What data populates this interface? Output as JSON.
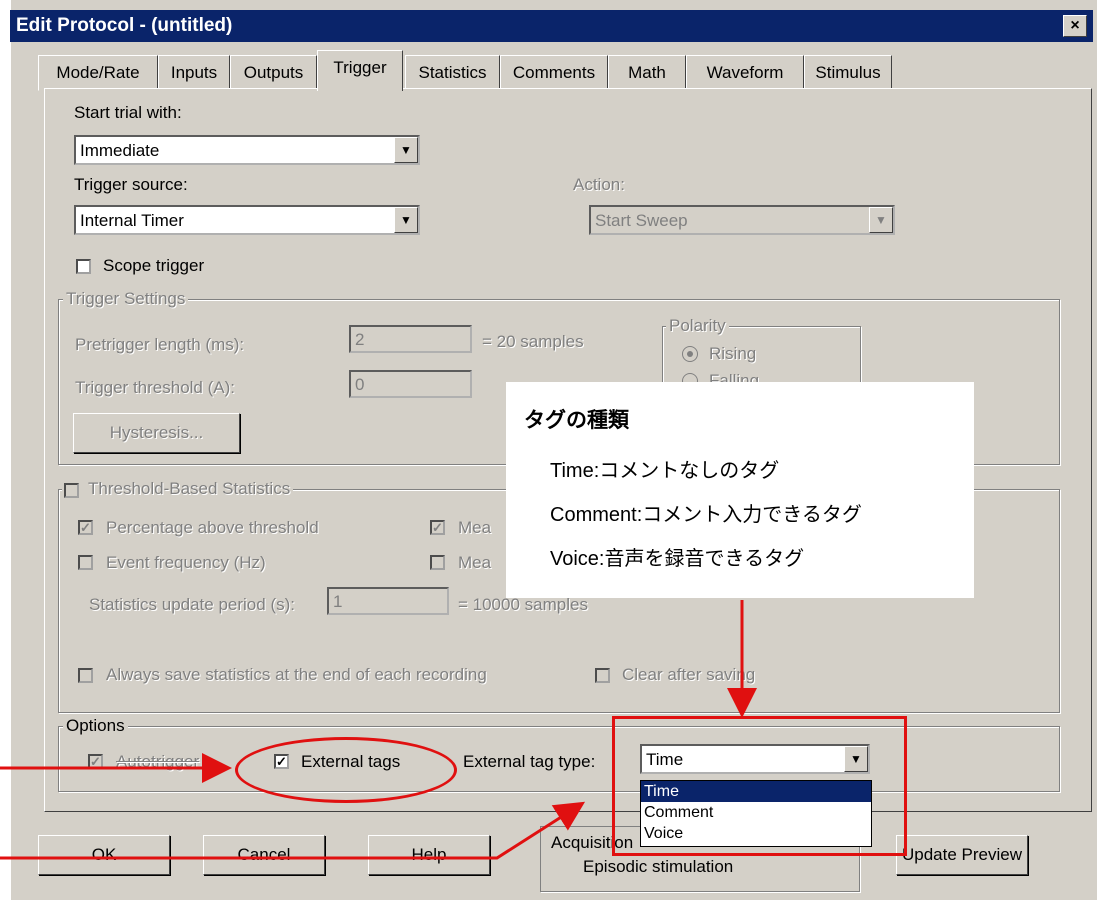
{
  "window": {
    "title": "Edit Protocol - (untitled)",
    "close_glyph": "×"
  },
  "tabs": [
    "Mode/Rate",
    "Inputs",
    "Outputs",
    "Trigger",
    "Statistics",
    "Comments",
    "Math",
    "Waveform",
    "Stimulus"
  ],
  "active_tab": "Trigger",
  "start_trial": {
    "label": "Start trial with:",
    "value": "Immediate"
  },
  "trigger_source": {
    "label": "Trigger source:",
    "value": "Internal Timer"
  },
  "action": {
    "label": "Action:",
    "value": "Start Sweep"
  },
  "scope_trigger": {
    "label": "Scope trigger",
    "checked": false
  },
  "trigger_settings": {
    "title": "Trigger Settings",
    "pretrigger_label": "Pretrigger length (ms):",
    "pretrigger_value": "2",
    "pretrigger_samples": "= 20 samples",
    "threshold_label": "Trigger threshold  (A):",
    "threshold_value": "0",
    "hysteresis_button": "Hysteresis...",
    "polarity_title": "Polarity",
    "polarity_rising": "Rising",
    "polarity_falling": "Falling"
  },
  "threshold_stats": {
    "title": "Threshold-Based Statistics",
    "percentage_label": "Percentage above threshold",
    "event_freq_label": "Event frequency (Hz)",
    "mean_label_1": "Mea",
    "mean_label_2": "Mea",
    "update_label": "Statistics update period (s):",
    "update_value": "1",
    "update_samples": "= 10000 samples",
    "always_save_label": "Always save statistics at the end of each recording",
    "clear_after_label": "Clear after saving"
  },
  "options": {
    "title": "Options",
    "autotrigger_label": "Autotrigger",
    "external_tags_label": "External tags",
    "external_tag_type_label": "External tag type:",
    "external_tag_type_value": "Time",
    "dropdown_options": [
      "Time",
      "Comment",
      "Voice"
    ]
  },
  "buttons": {
    "ok": "OK",
    "cancel": "Cancel",
    "help": "Help",
    "update_preview": "Update Preview"
  },
  "acquisition_box": {
    "line1": "Acquisition",
    "line2": "Episodic stimulation"
  },
  "annotation": {
    "heading": "タグの種類",
    "line1": "Time:コメントなしのタグ",
    "line2": "Comment:コメント入力できるタグ",
    "line3": "Voice:音声を録音できるタグ"
  },
  "colors": {
    "title_bar": "#0a246a",
    "dialog_bg": "#d4d0c8",
    "annotation_red": "#e01010"
  }
}
